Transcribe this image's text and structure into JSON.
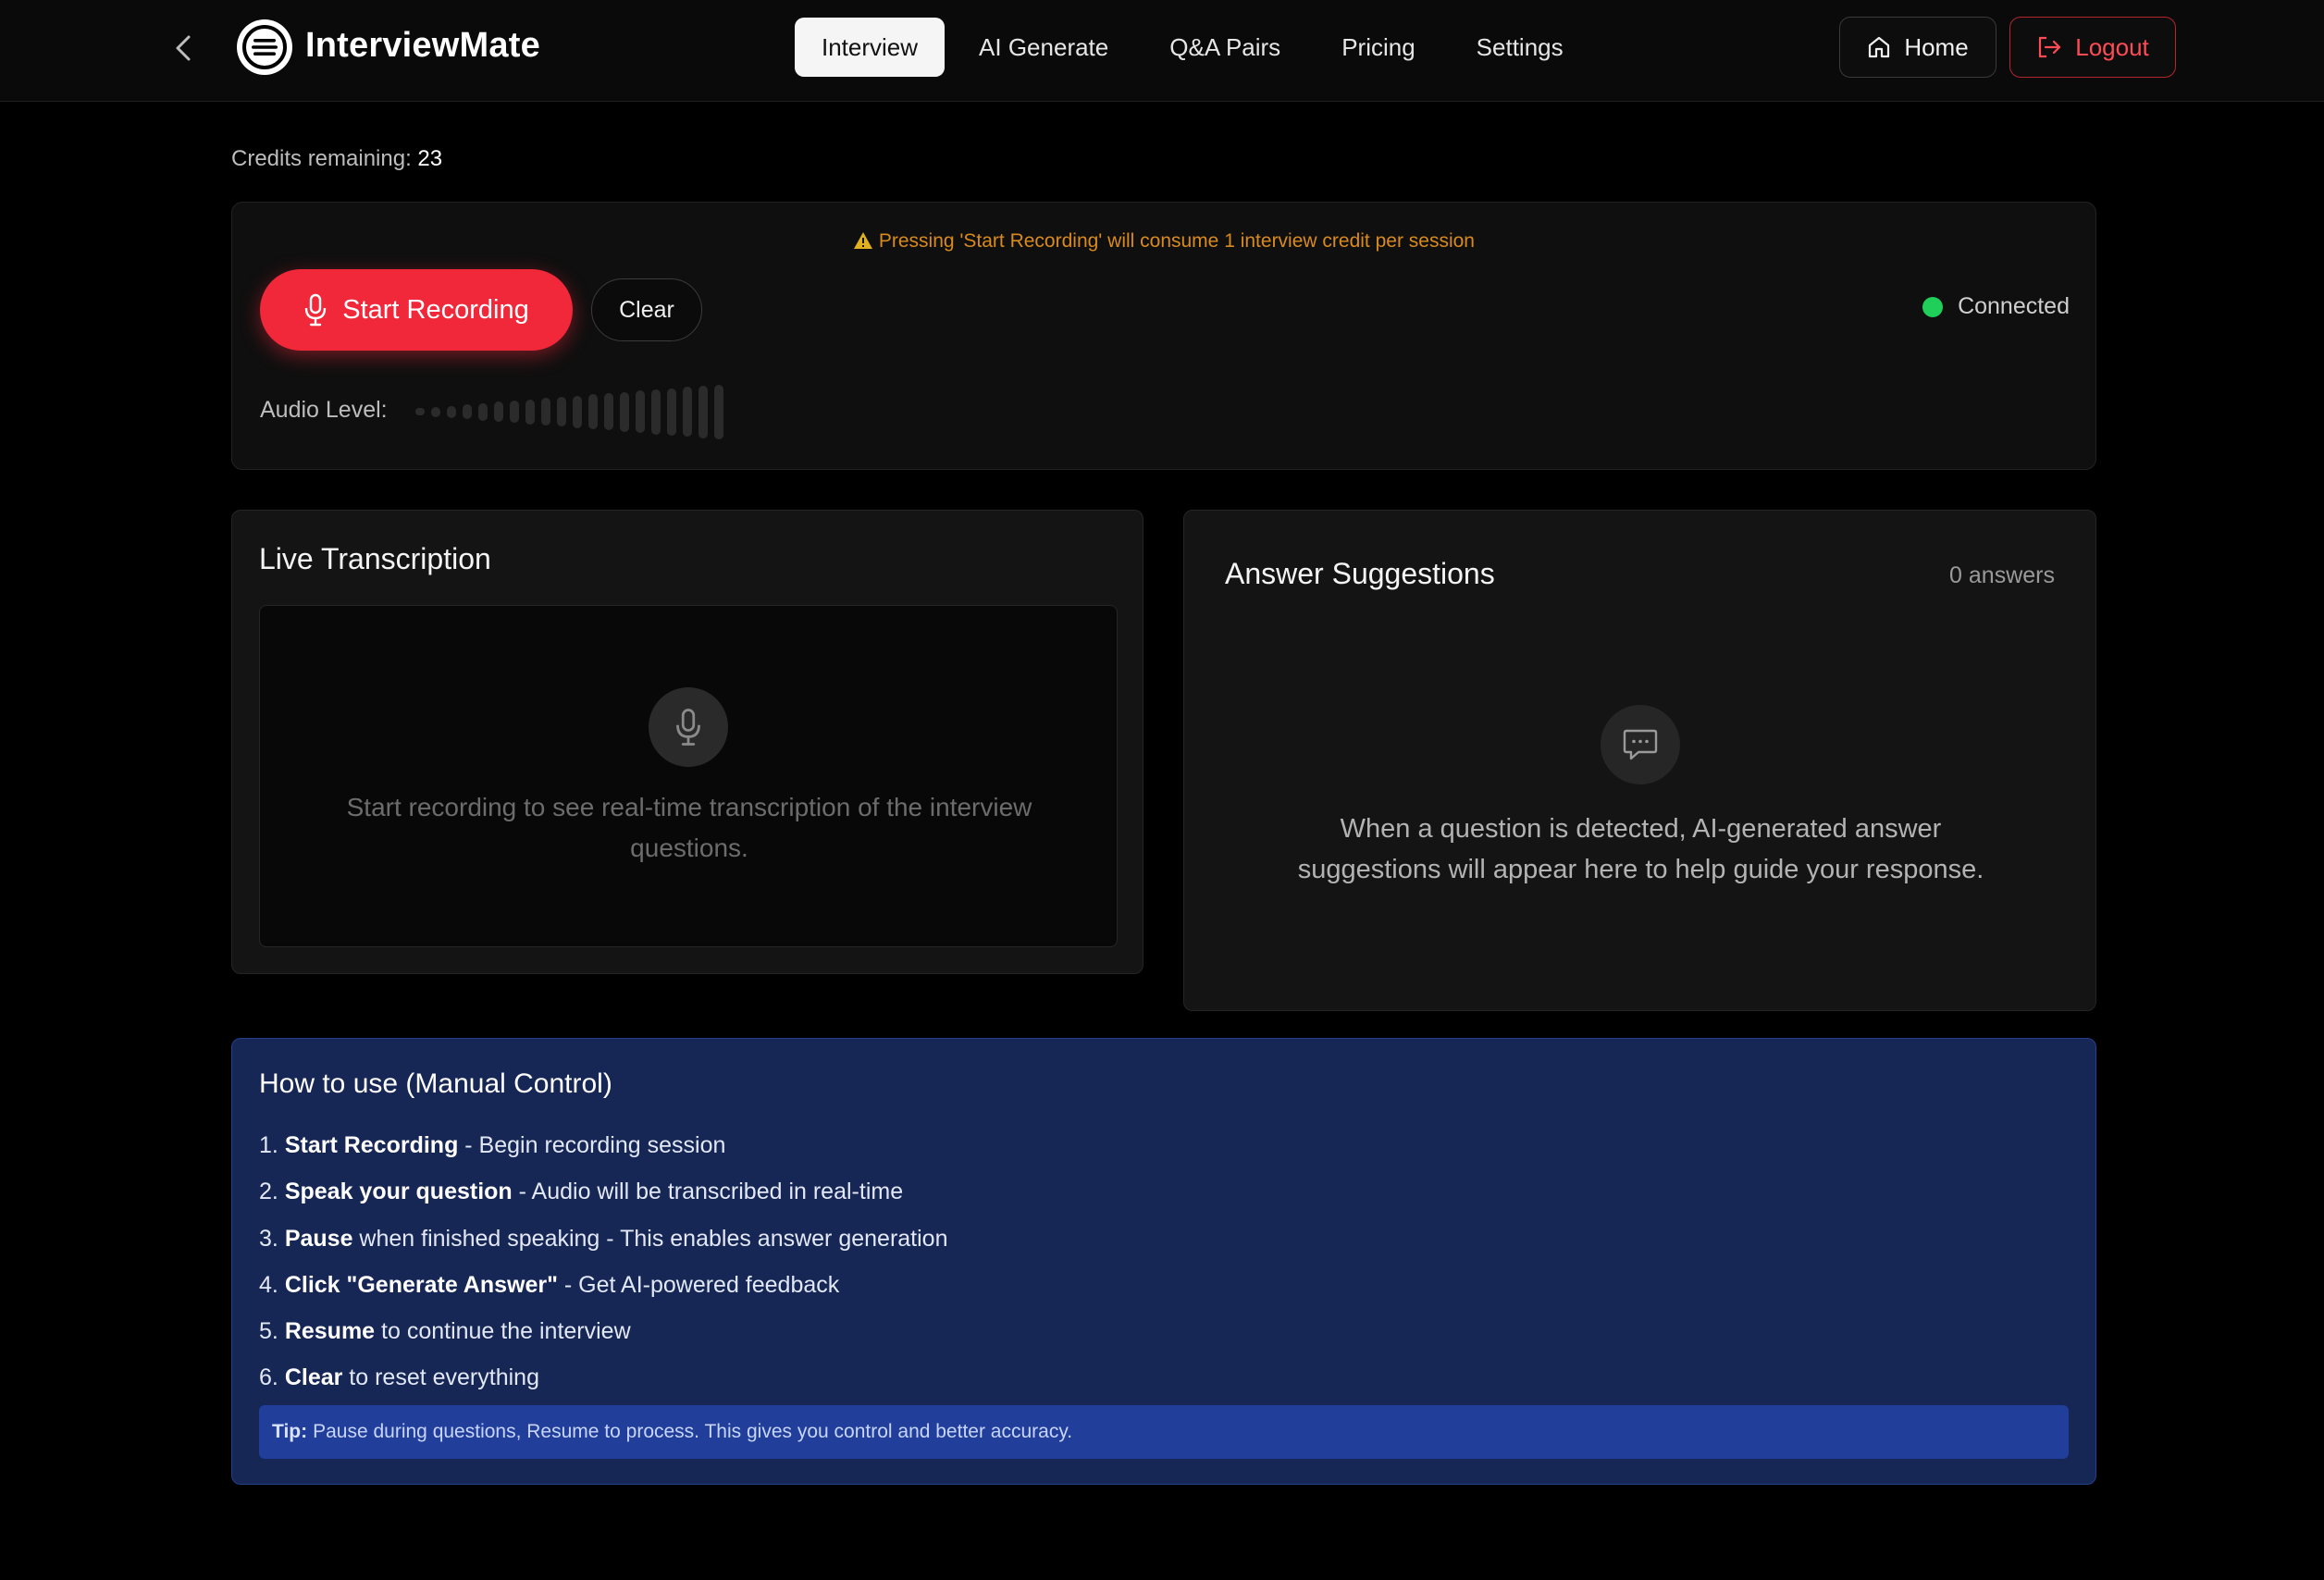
{
  "app": {
    "name": "InterviewMate"
  },
  "nav": {
    "tabs": [
      {
        "label": "Interview",
        "active": true
      },
      {
        "label": "AI Generate",
        "active": false
      },
      {
        "label": "Q&A Pairs",
        "active": false
      },
      {
        "label": "Pricing",
        "active": false
      },
      {
        "label": "Settings",
        "active": false
      }
    ],
    "home_label": "Home",
    "logout_label": "Logout"
  },
  "credits": {
    "label": "Credits remaining:",
    "value": "23"
  },
  "control": {
    "warning": "Pressing 'Start Recording' will consume 1 interview credit per session",
    "start_label": "Start Recording",
    "clear_label": "Clear",
    "status": "Connected",
    "audio_label": "Audio Level:",
    "audio_level": 0
  },
  "live": {
    "title": "Live Transcription",
    "empty_message": "Start recording to see real-time transcription of the interview questions."
  },
  "answers": {
    "title": "Answer Suggestions",
    "count": "0 answers",
    "empty_message": "When a question is detected, AI-generated answer suggestions will appear here to help guide your response."
  },
  "howto": {
    "title": "How to use (Manual Control)",
    "steps": [
      {
        "num": "1.",
        "bold": "Start Recording",
        "rest": " - Begin recording session"
      },
      {
        "num": "2.",
        "bold": "Speak your question",
        "rest": " - Audio will be transcribed in real-time"
      },
      {
        "num": "3.",
        "bold": "Pause",
        "rest": " when finished speaking - This enables answer generation"
      },
      {
        "num": "4.",
        "bold": "Click \"Generate Answer\"",
        "rest": " - Get AI-powered feedback"
      },
      {
        "num": "5.",
        "bold": "Resume",
        "rest": " to continue the interview"
      },
      {
        "num": "6.",
        "bold": "Clear",
        "rest": " to reset everything"
      }
    ],
    "tip_label": "Tip:",
    "tip_text": "Pause during questions, Resume to process. This gives you control and better accuracy."
  },
  "colors": {
    "accent_red": "#f1283a",
    "connected_green": "#1fcf5a",
    "warning_orange": "#d98a1c",
    "howto_bg": "#162655"
  },
  "icons": [
    "chevron-left-icon",
    "logo-icon",
    "home-icon",
    "logout-icon",
    "warning-icon",
    "microphone-icon",
    "chat-icon"
  ]
}
